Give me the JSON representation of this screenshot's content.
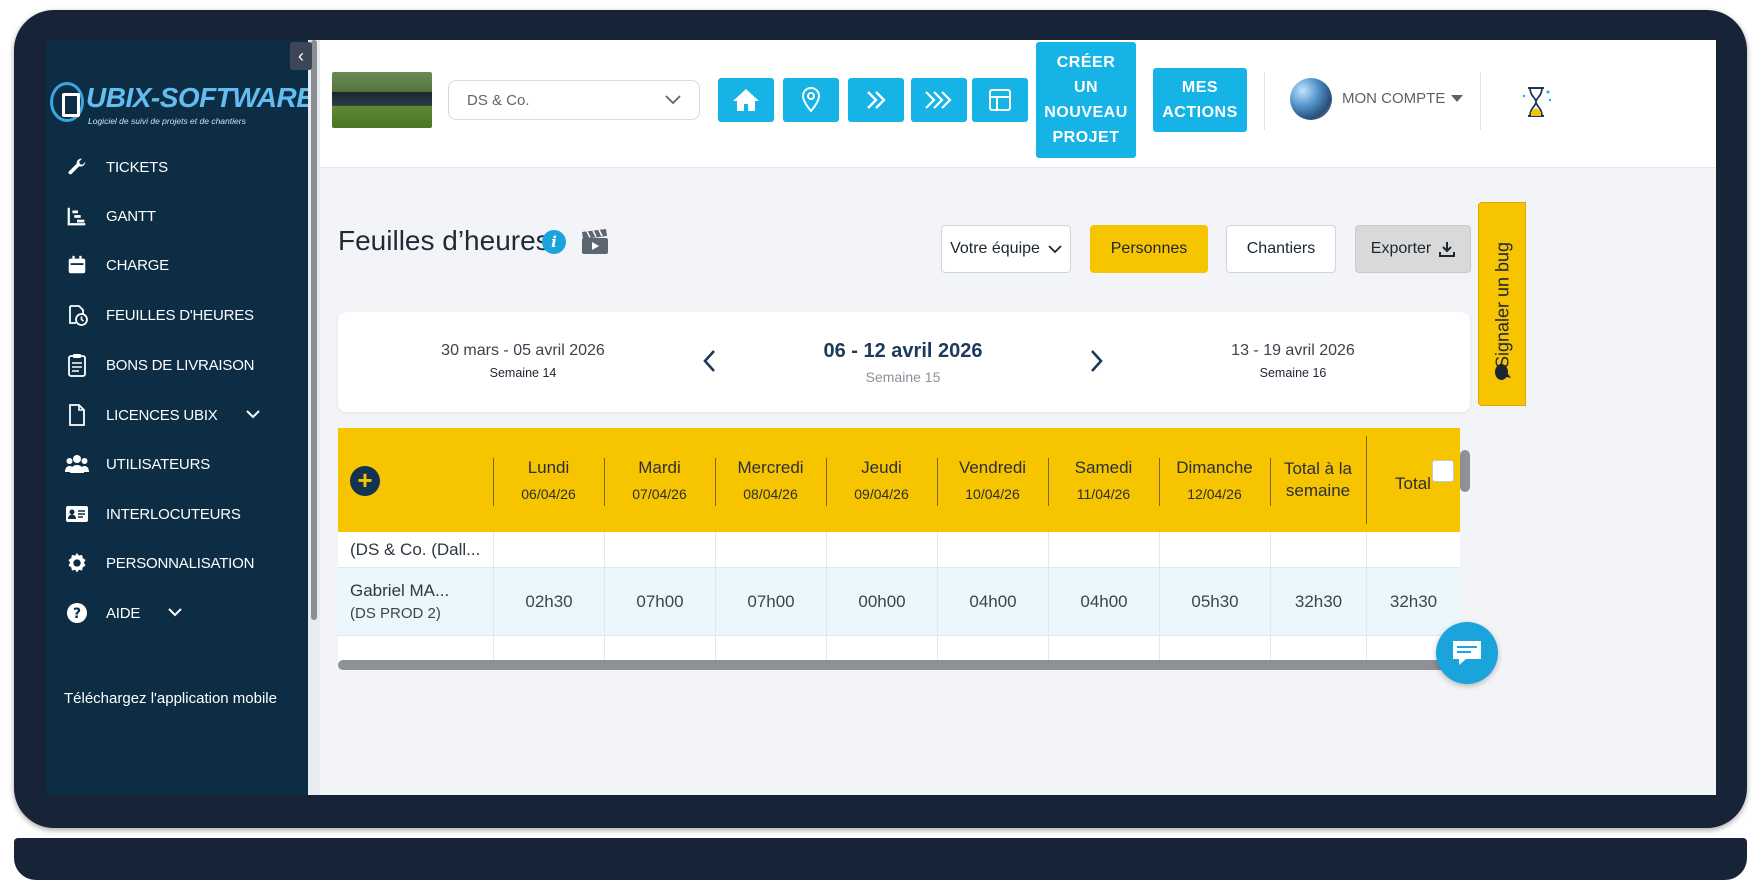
{
  "brand": {
    "name": "UBIX-SOFTWARE",
    "tagline": "Logiciel de suivi de projets et de chantiers"
  },
  "sidebar": {
    "items": [
      {
        "label": "TICKETS",
        "icon": "wrench-icon"
      },
      {
        "label": "GANTT",
        "icon": "gantt-icon"
      },
      {
        "label": "CHARGE",
        "icon": "calendar-icon"
      },
      {
        "label": "FEUILLES D'HEURES",
        "icon": "timesheet-icon"
      },
      {
        "label": "BONS DE LIVRAISON",
        "icon": "clipboard-icon"
      },
      {
        "label": "LICENCES UBIX",
        "icon": "document-icon"
      },
      {
        "label": "UTILISATEURS",
        "icon": "users-icon"
      },
      {
        "label": "INTERLOCUTEURS",
        "icon": "contact-card-icon"
      },
      {
        "label": "PERSONNALISATION",
        "icon": "gear-icon"
      },
      {
        "label": "AIDE",
        "icon": "help-icon"
      }
    ],
    "mobile_app": "Téléchargez l'application mobile"
  },
  "header": {
    "project_select": "DS & Co.",
    "create_project": "CRÉER UN NOUVEAU PROJET",
    "my_actions": "MES ACTIONS",
    "account": "MON COMPTE"
  },
  "page": {
    "title": "Feuilles d’heures",
    "team_select": "Votre équipe",
    "persons": "Personnes",
    "sites": "Chantiers",
    "export": "Exporter",
    "report_bug": "Signaler un bug"
  },
  "weeks": {
    "prev": {
      "range": "30 mars - 05 avril 2026",
      "label": "Semaine 14"
    },
    "current": {
      "range": "06 - 12 avril 2026",
      "label": "Semaine 15"
    },
    "next": {
      "range": "13 - 19 avril 2026",
      "label": "Semaine 16"
    }
  },
  "table": {
    "days": [
      {
        "day": "Lundi",
        "date": "06/04/26"
      },
      {
        "day": "Mardi",
        "date": "07/04/26"
      },
      {
        "day": "Mercredi",
        "date": "08/04/26"
      },
      {
        "day": "Jeudi",
        "date": "09/04/26"
      },
      {
        "day": "Vendredi",
        "date": "10/04/26"
      },
      {
        "day": "Samedi",
        "date": "11/04/26"
      },
      {
        "day": "Dimanche",
        "date": "12/04/26"
      }
    ],
    "week_total": "Total à la semaine",
    "total": "Total",
    "rows": [
      {
        "name": "(DS & Co. (Dall...",
        "sub": "",
        "values": [
          "",
          "",
          "",
          "",
          "",
          "",
          "",
          "",
          ""
        ]
      },
      {
        "name": "Gabriel MA...",
        "sub": "(DS PROD 2)",
        "values": [
          "02h30",
          "07h00",
          "07h00",
          "00h00",
          "04h00",
          "04h00",
          "05h30",
          "32h30",
          "32h30"
        ]
      }
    ]
  },
  "colors": {
    "sidebar": "#0d2d45",
    "accent_blue": "#16b4e6",
    "accent_yellow": "#f7c400"
  }
}
